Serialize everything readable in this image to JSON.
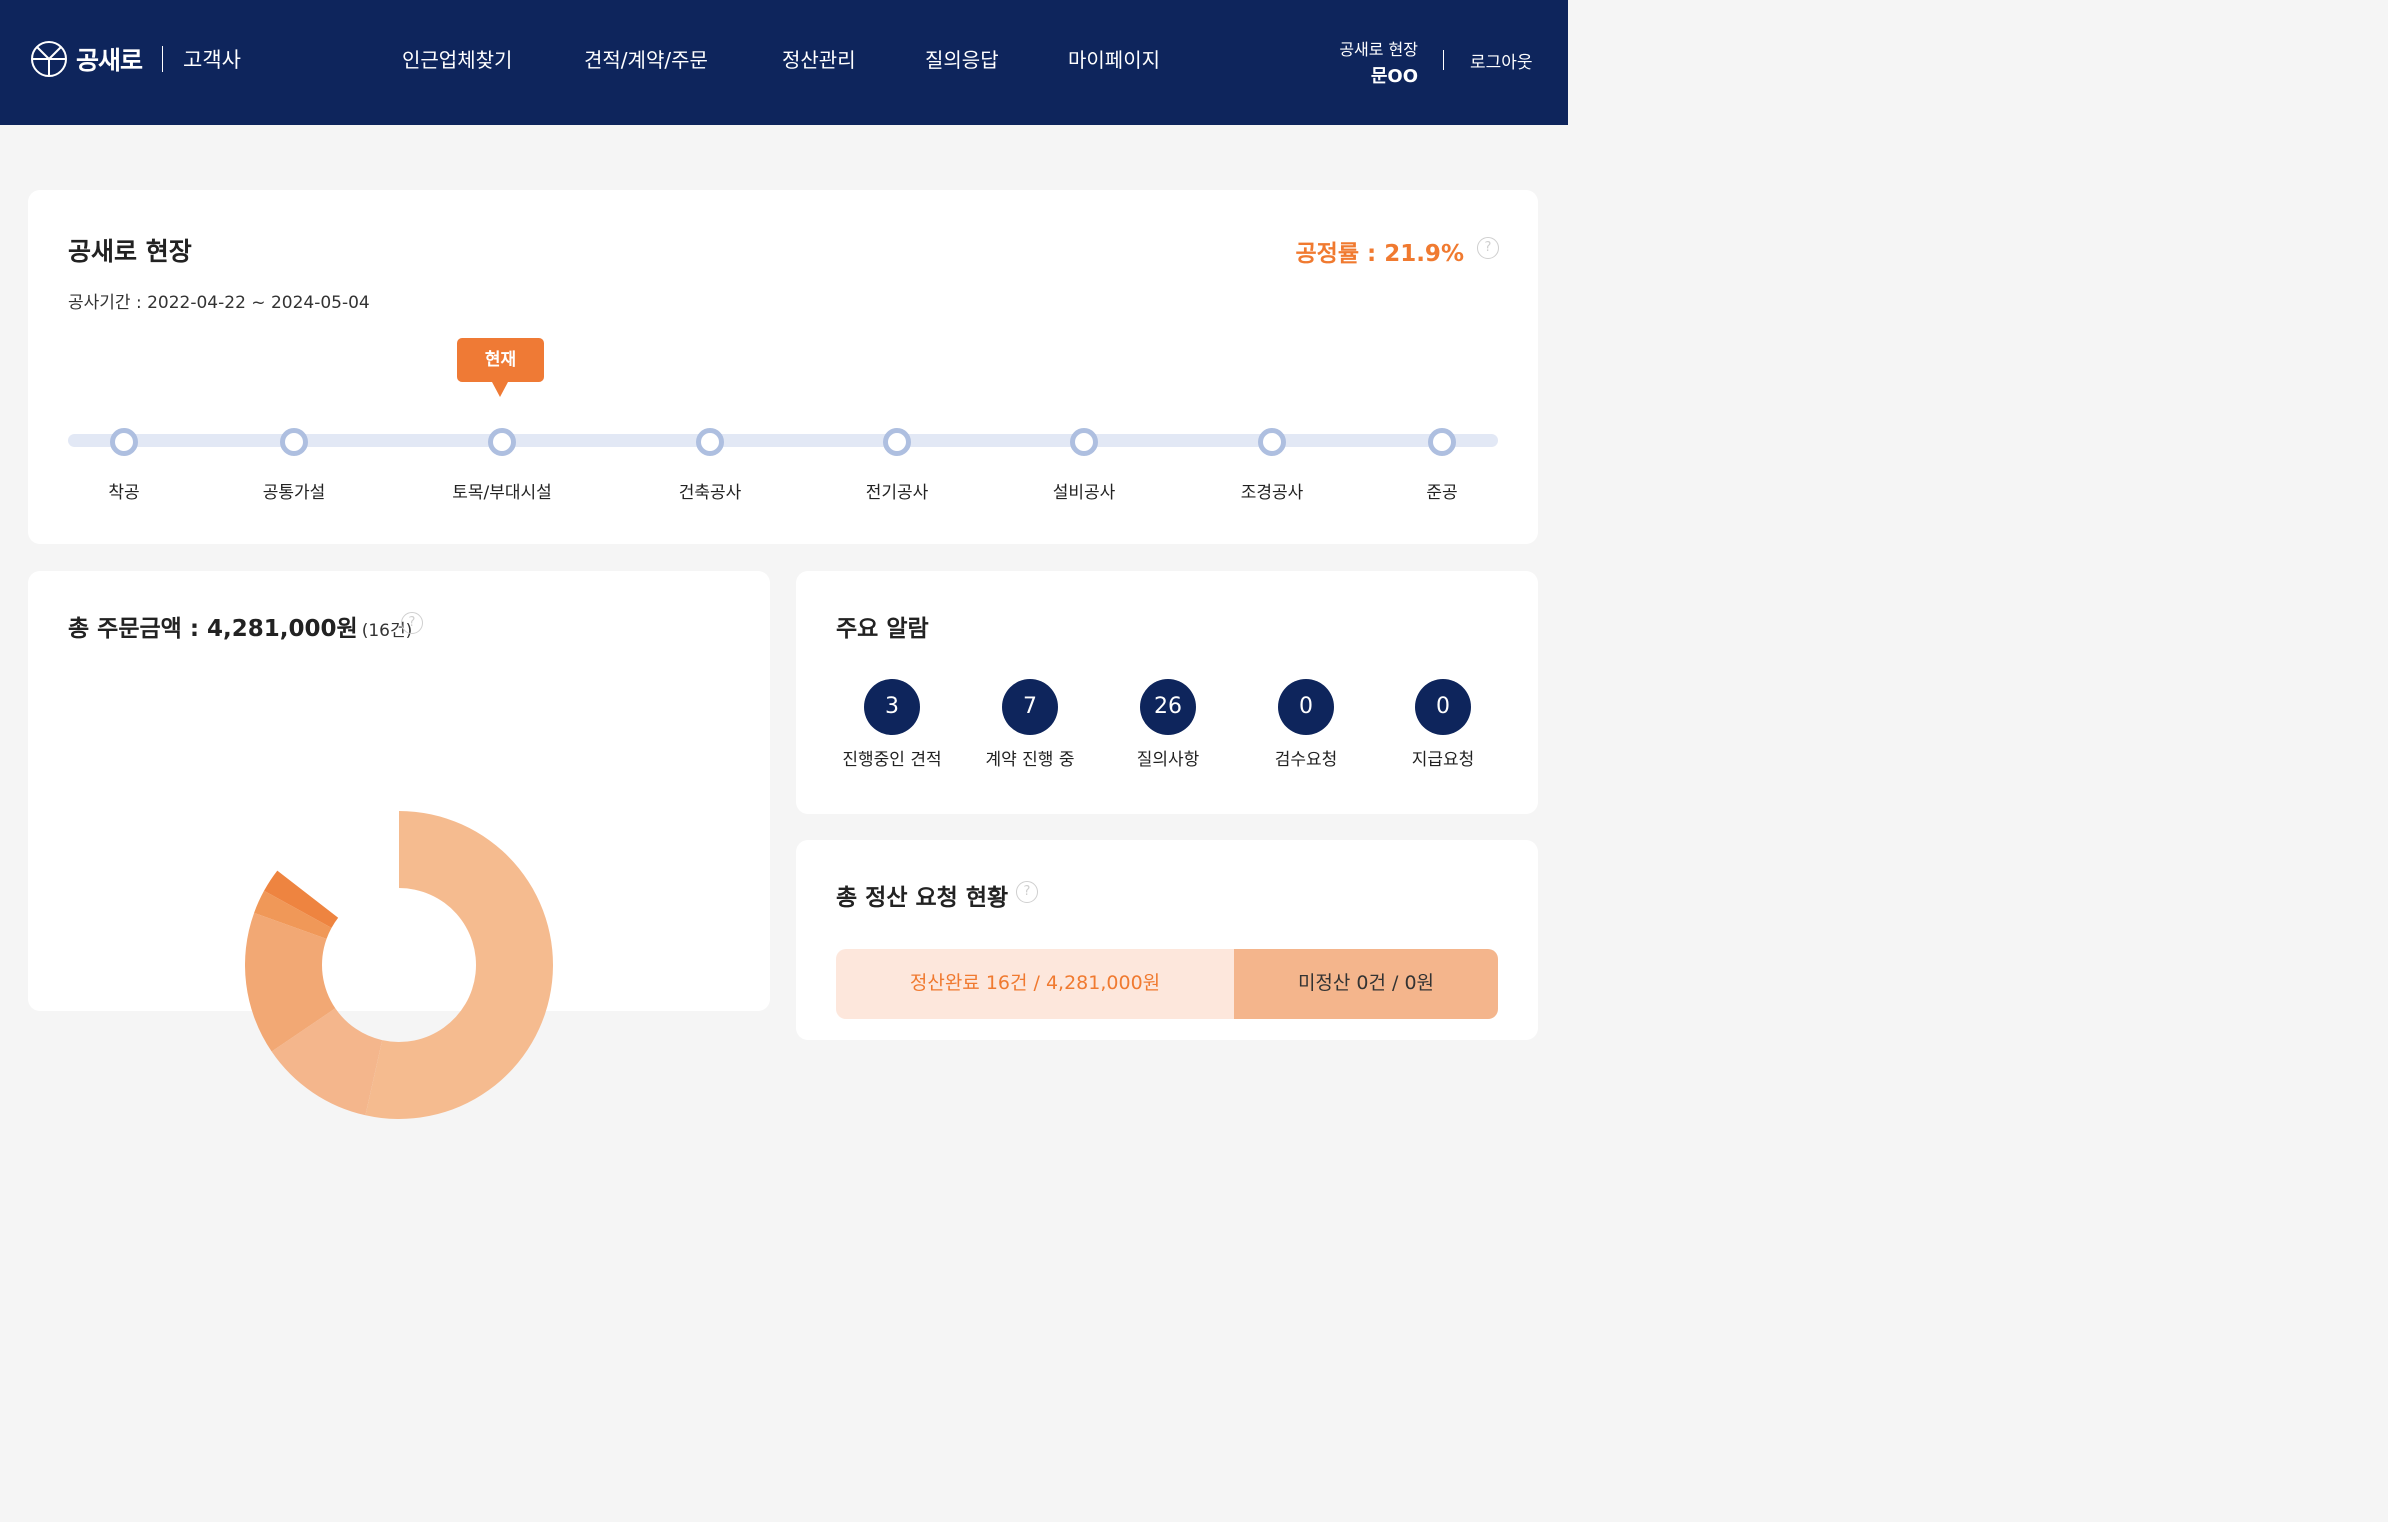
{
  "header": {
    "logo_text": "공새로",
    "logo_sub": "고객사",
    "nav": [
      "인근업체찾기",
      "견적/계약/주문",
      "정산관리",
      "질의응답",
      "마이페이지"
    ],
    "user_site": "공새로 현장",
    "user_name": "문OO",
    "logout": "로그아웃"
  },
  "site": {
    "title": "공새로 현장",
    "period": "공사기간 : 2022-04-22 ~ 2024-05-04",
    "progress_rate": "공정률 : 21.9%",
    "current_badge": "현재",
    "current_step": 2,
    "steps": [
      "착공",
      "공통가설",
      "토목/부대시설",
      "건축공사",
      "전기공사",
      "설비공사",
      "조경공사",
      "준공"
    ]
  },
  "order": {
    "title": "총 주문금액 : 4,281,000원",
    "count": "(16건)",
    "chart_data": {
      "type": "pie",
      "slices": [
        {
          "value": 0.535,
          "color": "#f5bb8f"
        },
        {
          "value": 0.12,
          "color": "#f4b68c"
        },
        {
          "value": 0.15,
          "color": "#f2a874"
        },
        {
          "value": 0.025,
          "color": "#f09858"
        },
        {
          "value": 0.025,
          "color": "#ee8440"
        }
      ]
    }
  },
  "alarm": {
    "title": "주요 알람",
    "items": [
      {
        "count": "3",
        "label": "진행중인 견적"
      },
      {
        "count": "7",
        "label": "계약 진행 중"
      },
      {
        "count": "26",
        "label": "질의사항"
      },
      {
        "count": "0",
        "label": "검수요청"
      },
      {
        "count": "0",
        "label": "지급요청"
      }
    ]
  },
  "settlement": {
    "title": "총 정산 요청 현황",
    "done": "정산완료 16건 / 4,281,000원",
    "pending": "미정산 0건 / 0원"
  }
}
